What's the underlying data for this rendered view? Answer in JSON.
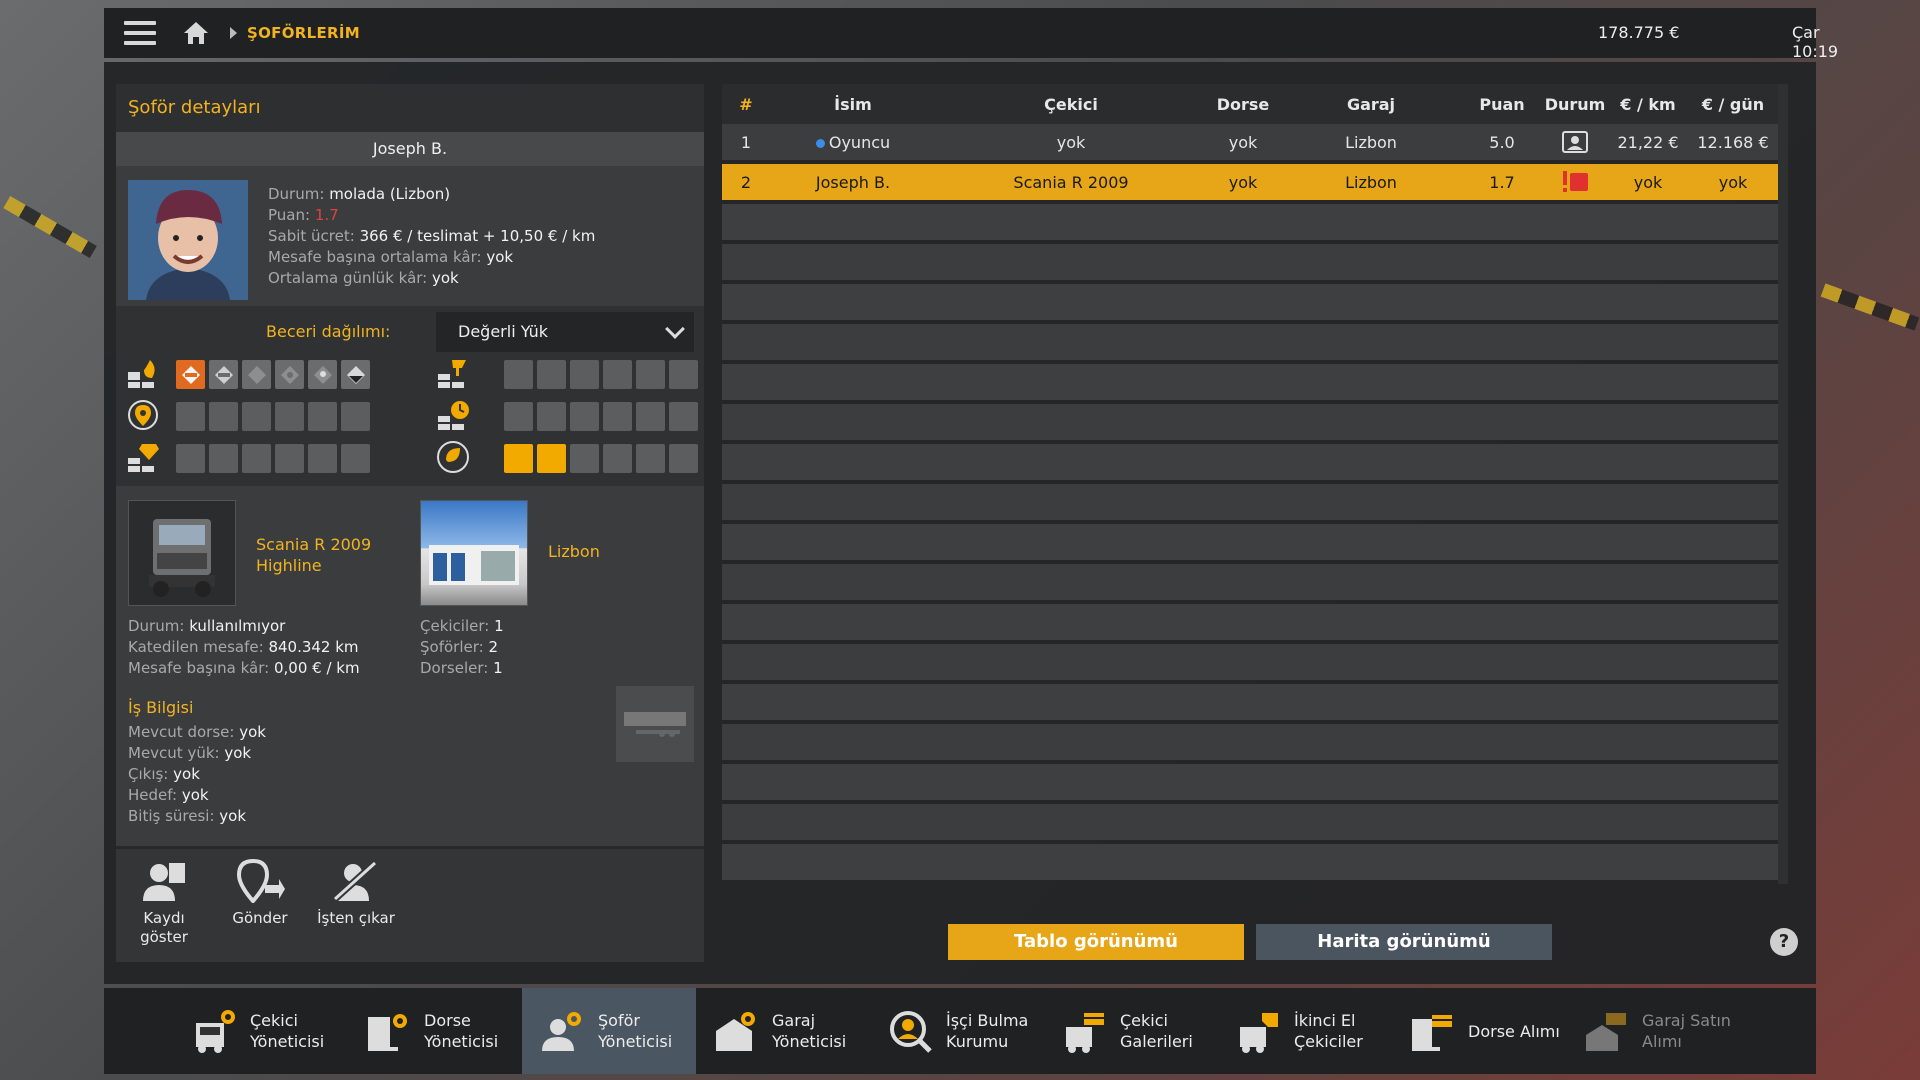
{
  "topbar": {
    "breadcrumb": "ŞOFÖRLERİM",
    "money": "178.775 €",
    "clock": "Çar 10:19"
  },
  "detail": {
    "title": "Şoför detayları",
    "driver_name": "Joseph B.",
    "status_label": "Durum:",
    "status_value": "molada (Lizbon)",
    "score_label": "Puan:",
    "score_value": "1.7",
    "fixed_label": "Sabit ücret:",
    "fixed_value": "366 € / teslimat + 10,50 € / km",
    "avg_km_label": "Mesafe başına ortalama kâr:",
    "avg_km_value": "yok",
    "avg_day_label": "Ortalama günlük kâr:",
    "avg_day_value": "yok",
    "skills_title": "Beceri dağılımı:",
    "skills_dropdown": "Değerli Yük",
    "skills": {
      "adr": 1,
      "long_distance": 0,
      "high_value": 0,
      "fragile": 0,
      "urgent": 0,
      "eco_driving": 2
    },
    "truck_name_1": "Scania R 2009",
    "truck_name_2": "Highline",
    "garage_name": "Lizbon",
    "truck_status_label": "Durum:",
    "truck_status_value": "kullanılmıyor",
    "distance_label": "Katedilen mesafe:",
    "distance_value": "840.342 km",
    "profit_km_label": "Mesafe başına kâr:",
    "profit_km_value": "0,00 € / km",
    "trucks_label": "Çekiciler:",
    "trucks_value": "1",
    "drivers_label": "Şoförler:",
    "drivers_value": "2",
    "trailers_label": "Dorseler:",
    "trailers_value": "1",
    "job_title": "İş Bilgisi",
    "cur_trailer_label": "Mevcut dorse:",
    "cur_trailer_value": "yok",
    "cur_cargo_label": "Mevcut yük:",
    "cur_cargo_value": "yok",
    "origin_label": "Çıkış:",
    "origin_value": "yok",
    "dest_label": "Hedef:",
    "dest_value": "yok",
    "end_label": "Bitiş süresi:",
    "end_value": "yok",
    "actions": {
      "show_record_1": "Kaydı",
      "show_record_2": "göster",
      "send": "Gönder",
      "fire": "İşten çıkar"
    }
  },
  "table": {
    "headers": {
      "num": "#",
      "name": "İsim",
      "truck": "Çekici",
      "trailer": "Dorse",
      "garage": "Garaj",
      "score": "Puan",
      "status": "Durum",
      "per_km": "€ / km",
      "per_day": "€ / gün"
    },
    "rows": [
      {
        "num": "1",
        "name": "Oyuncu",
        "truck": "yok",
        "trailer": "yok",
        "garage": "Lizbon",
        "score": "5.0",
        "per_km": "21,22 €",
        "per_day": "12.168 €"
      },
      {
        "num": "2",
        "name": "Joseph B.",
        "truck": "Scania R 2009",
        "trailer": "yok",
        "garage": "Lizbon",
        "score": "1.7",
        "per_km": "yok",
        "per_day": "yok"
      }
    ]
  },
  "buttons": {
    "table_view": "Tablo görünümü",
    "map_view": "Harita görünümü",
    "help": "?"
  },
  "nav": [
    {
      "l1": "Çekici",
      "l2": "Yöneticisi"
    },
    {
      "l1": "Dorse",
      "l2": "Yöneticisi"
    },
    {
      "l1": "Şoför",
      "l2": "Yöneticisi"
    },
    {
      "l1": "Garaj",
      "l2": "Yöneticisi"
    },
    {
      "l1": "İşçi Bulma",
      "l2": "Kurumu"
    },
    {
      "l1": "Çekici",
      "l2": "Galerileri"
    },
    {
      "l1": "İkinci El",
      "l2": "Çekiciler"
    },
    {
      "l1": "Dorse Alımı",
      "l2": ""
    },
    {
      "l1": "Garaj Satın",
      "l2": "Alımı"
    }
  ],
  "colors": {
    "accent": "#e6a617",
    "active_nav": "#4a5662",
    "warning": "#e04040"
  },
  "icons": [
    "menu-icon",
    "home-icon",
    "adr-icon",
    "distance-icon",
    "high-value-icon",
    "fragile-icon",
    "urgent-icon",
    "eco-icon",
    "driver-icon",
    "warning-icon",
    "truck-icon",
    "trailer-icon",
    "garage-icon",
    "recruit-icon",
    "dealer-icon"
  ]
}
